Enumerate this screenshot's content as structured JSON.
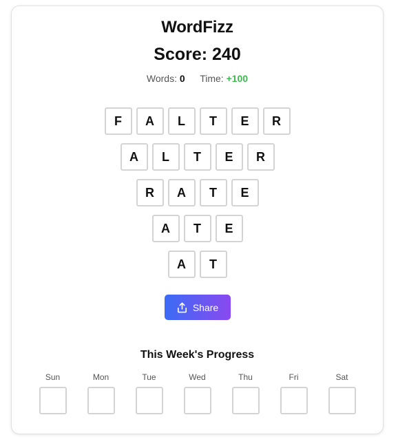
{
  "app": {
    "title": "WordFizz"
  },
  "score": {
    "label": "Score: 240"
  },
  "stats": {
    "words_label": "Words:",
    "words_value": "0",
    "time_label": "Time:",
    "time_value": "+100",
    "time_color": "#3fb950"
  },
  "board": {
    "rows": [
      [
        "F",
        "A",
        "L",
        "T",
        "E",
        "R"
      ],
      [
        "A",
        "L",
        "T",
        "E",
        "R"
      ],
      [
        "R",
        "A",
        "T",
        "E"
      ],
      [
        "A",
        "T",
        "E"
      ],
      [
        "A",
        "T"
      ]
    ]
  },
  "share": {
    "label": "Share",
    "icon": "share-icon",
    "gradient_start": "#3b6cf5",
    "gradient_end": "#8a49f0"
  },
  "progress": {
    "title": "This Week's Progress",
    "days": [
      "Sun",
      "Mon",
      "Tue",
      "Wed",
      "Thu",
      "Fri",
      "Sat"
    ]
  }
}
